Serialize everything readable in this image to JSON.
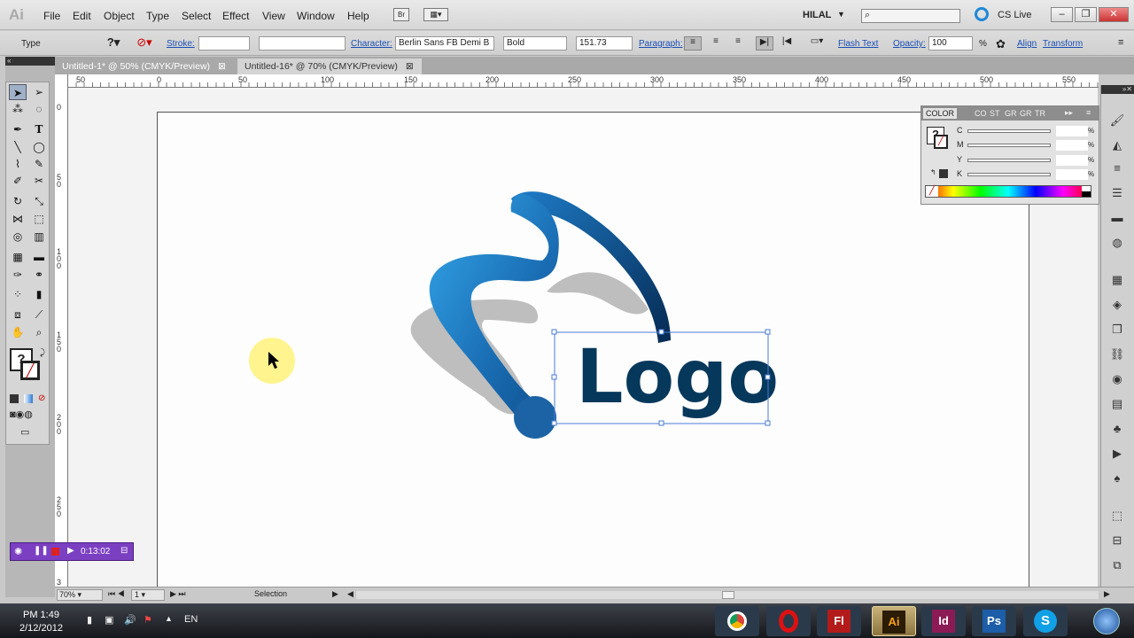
{
  "app": {
    "logo": "Ai"
  },
  "menu": [
    "File",
    "Edit",
    "Object",
    "Type",
    "Select",
    "Effect",
    "View",
    "Window",
    "Help"
  ],
  "workspace": {
    "name": "HILAL",
    "cslive": "CS Live"
  },
  "control": {
    "tool_label": "Type",
    "stroke_label": "Stroke:",
    "character_label": "Character:",
    "font_family": "Berlin Sans FB Demi B",
    "font_style": "Bold",
    "font_size": "151.73",
    "paragraph_label": "Paragraph:",
    "flash_text": "Flash Text",
    "opacity_label": "Opacity:",
    "opacity_value": "100",
    "opacity_unit": "%",
    "align_label": "Align",
    "transform_label": "Transform"
  },
  "tabs": [
    {
      "label": "Untitled-1* @ 50% (CMYK/Preview)",
      "active": false
    },
    {
      "label": "Untitled-16* @ 70% (CMYK/Preview)",
      "active": true
    }
  ],
  "ruler": {
    "h_labels": [
      "50",
      "0",
      "50",
      "100",
      "150",
      "200",
      "250",
      "300",
      "350",
      "400",
      "450",
      "500",
      "550"
    ],
    "v_labels": [
      "0",
      "5 0",
      "1 0 0",
      "1 5 0",
      "2 0 0",
      "2 5 0",
      "3"
    ]
  },
  "artwork": {
    "logo_text": "Logo",
    "colors": {
      "blue_light": "#2c9be0",
      "blue_dark": "#0b3a6e",
      "text": "#06385c",
      "shadow": "#bdbdbd"
    }
  },
  "color_panel": {
    "tab": "COLOR",
    "other_tabs": [
      "CO",
      "ST",
      "GR",
      "GR",
      "TR"
    ],
    "channels": [
      "C",
      "M",
      "Y",
      "K"
    ],
    "percent": "%"
  },
  "recorder": {
    "time": "0:13:02"
  },
  "status": {
    "zoom": "70%",
    "page": "1",
    "tool": "Selection"
  },
  "taskbar": {
    "time": "PM 1:49",
    "date": "2/12/2012",
    "language": "EN",
    "apps": [
      {
        "label": "",
        "icon": "chrome-icon",
        "color": "#2a7d2a"
      },
      {
        "label": "",
        "icon": "opera-icon",
        "color": "#c8102e"
      },
      {
        "label": "Fl",
        "icon": "flash-icon",
        "color": "#b31b1b"
      },
      {
        "label": "Ai",
        "icon": "illustrator-icon",
        "color": "#f07d00"
      },
      {
        "label": "Id",
        "icon": "indesign-icon",
        "color": "#8c1b55"
      },
      {
        "label": "Ps",
        "icon": "photoshop-icon",
        "color": "#1c5ea8"
      },
      {
        "label": "S",
        "icon": "skype-icon",
        "color": "#11a0e5"
      },
      {
        "label": "",
        "icon": "windows-icon",
        "color": "#3a6fc0"
      }
    ]
  }
}
